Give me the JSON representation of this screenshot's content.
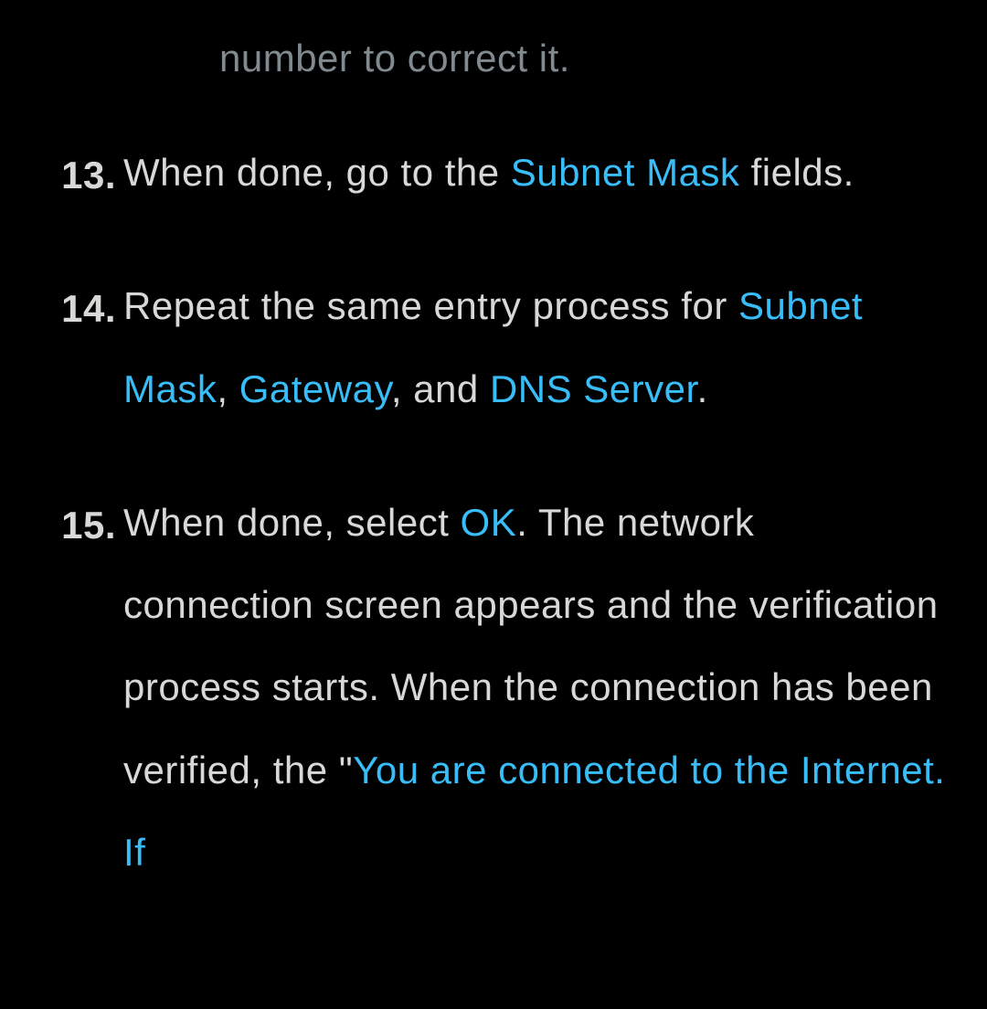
{
  "fragment": "number to correct it.",
  "items": [
    {
      "number": "13.",
      "parts": [
        {
          "text": "When done, go to the ",
          "highlight": false
        },
        {
          "text": "Subnet Mask",
          "highlight": true
        },
        {
          "text": " fields.",
          "highlight": false
        }
      ]
    },
    {
      "number": "14.",
      "parts": [
        {
          "text": "Repeat the same entry process for ",
          "highlight": false
        },
        {
          "text": "Subnet Mask",
          "highlight": true
        },
        {
          "text": ", ",
          "highlight": false
        },
        {
          "text": "Gateway",
          "highlight": true
        },
        {
          "text": ", and ",
          "highlight": false
        },
        {
          "text": "DNS Server",
          "highlight": true
        },
        {
          "text": ".",
          "highlight": false
        }
      ]
    },
    {
      "number": "15.",
      "parts": [
        {
          "text": "When done, select ",
          "highlight": false
        },
        {
          "text": "OK",
          "highlight": true
        },
        {
          "text": ". The network connection screen appears and the verification process starts. When the connection has been verified, the \"",
          "highlight": false
        },
        {
          "text": "You are connected to the Internet. If",
          "highlight": true
        }
      ]
    }
  ]
}
